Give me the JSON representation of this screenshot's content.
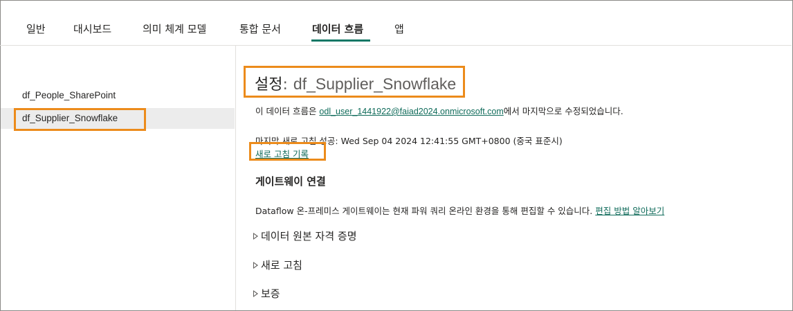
{
  "tabs": [
    {
      "label": "일반"
    },
    {
      "label": "대시보드"
    },
    {
      "label": "의미 체계 모델"
    },
    {
      "label": "통합 문서"
    },
    {
      "label": "데이터 흐름"
    },
    {
      "label": "앱"
    }
  ],
  "active_tab": "데이터 흐름",
  "sidebar": {
    "items": [
      {
        "label": "df_People_SharePoint"
      },
      {
        "label": "df_Supplier_Snowflake"
      }
    ],
    "selected": "df_Supplier_Snowflake"
  },
  "settings": {
    "title_label": "설정",
    "title_sep": ":",
    "title_name": "df_Supplier_Snowflake",
    "modified_prefix": "이 데이터 흐름은 ",
    "modified_user": "odl_user_1441922@faiad2024.onmicrosoft.com",
    "modified_suffix": "에서 마지막으로 수정되었습니다.",
    "last_refresh": "마지막 새로 고침 성공: Wed Sep 04 2024 12:41:55 GMT+0800 (중국 표준시)",
    "refresh_history_link": "새로 고침 기록"
  },
  "gateway": {
    "heading": "게이트웨이 연결",
    "text": "Dataflow 온-프레미스 게이트웨이는 현재 파워 쿼리 온라인 환경을 통해 편집할 수 있습니다. ",
    "learn_link": "편집 방법 알아보기"
  },
  "sections": [
    {
      "label": "데이터 원본 자격 증명"
    },
    {
      "label": "새로 고침"
    },
    {
      "label": "보증"
    }
  ],
  "colors": {
    "accent": "#117865",
    "highlight": "#ec8b1b",
    "selected_bg": "#ececec"
  }
}
